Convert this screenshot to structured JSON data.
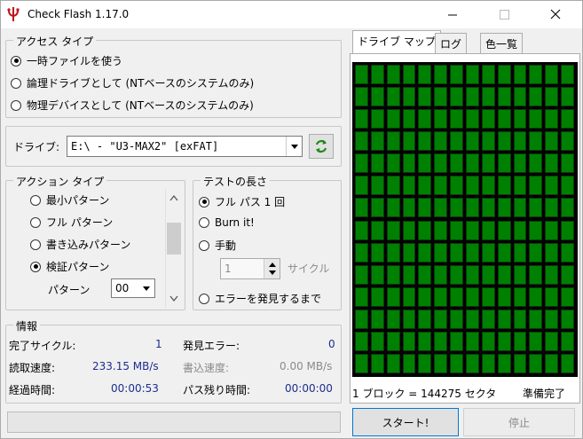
{
  "titlebar": {
    "title": "Check Flash 1.17.0"
  },
  "access_type": {
    "legend": "アクセス タイプ",
    "options": [
      "一時ファイルを使う",
      "論理ドライブとして (NTベースのシステムのみ)",
      "物理デバイスとして (NTベースのシステムのみ)"
    ],
    "selected_index": 0
  },
  "drive": {
    "label": "ドライブ:",
    "value": "E:\\ - \"U3-MAX2\" [exFAT]"
  },
  "action_type": {
    "legend": "アクション タイプ",
    "options": [
      "最小パターン",
      "フル パターン",
      "書き込みパターン",
      "検証パターン"
    ],
    "selected_index": 3,
    "pattern_label": "パターン",
    "pattern_value": "00"
  },
  "test_length": {
    "legend": "テストの長さ",
    "options": [
      "フル パス 1 回",
      "Burn it!",
      "手動",
      "エラーを発見するまで"
    ],
    "selected_index": 0,
    "cycles_value": "1",
    "cycles_label": "サイクル"
  },
  "info": {
    "legend": "情報",
    "completed_cycles_label": "完了サイクル:",
    "completed_cycles": "1",
    "errors_label": "発見エラー:",
    "errors": "0",
    "read_speed_label": "読取速度:",
    "read_speed": "233.15 MB/s",
    "write_speed_label": "書込速度:",
    "write_speed": "0.00 MB/s",
    "elapsed_label": "経過時間:",
    "elapsed": "00:00:53",
    "remaining_label": "パス残り時間:",
    "remaining": "00:00:00"
  },
  "progress": {
    "value": 0
  },
  "tabs": [
    "ドライブ マップ",
    "ログ",
    "色一覧"
  ],
  "active_tab": 0,
  "drive_map": {
    "cols": 14,
    "rows": 14,
    "block_color": "#008000"
  },
  "status": {
    "block_info": "1 ブロック = 144275 セクタ",
    "state": "準備完了"
  },
  "buttons": {
    "start": "スタート!",
    "stop": "停止"
  }
}
